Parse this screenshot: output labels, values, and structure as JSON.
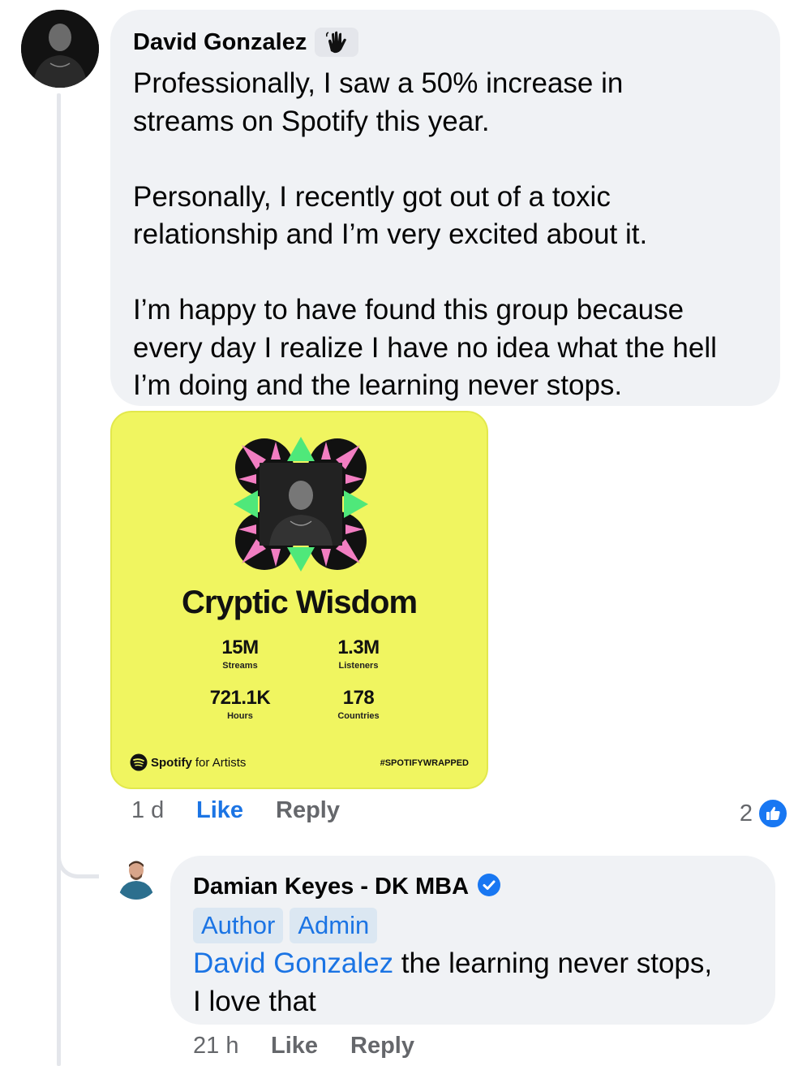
{
  "comment": {
    "author": "David Gonzalez",
    "paragraphs": [
      [
        "Professionally, I saw a 50% increase in",
        "streams on Spotify this year."
      ],
      [
        "Personally, I recently got out of a toxic",
        "relationship and I’m very excited about it."
      ],
      [
        "I’m happy to have found this group because",
        "every day I realize I have no idea what the hell",
        "I’m doing and the learning never stops."
      ]
    ],
    "badge_icon": "wave-hand-icon",
    "card": {
      "artist": "Cryptic Wisdom",
      "stats": [
        {
          "value": "15M",
          "label": "Streams"
        },
        {
          "value": "1.3M",
          "label": "Listeners"
        },
        {
          "value": "721.1K",
          "label": "Hours"
        },
        {
          "value": "178",
          "label": "Countries"
        }
      ],
      "brand": "Spotify",
      "brand_suffix": "for Artists",
      "hashtag": "#SPOTIFYWRAPPED",
      "colors": {
        "background": "#f0f560",
        "pink": "#f27ec2",
        "green": "#4fe87a"
      }
    },
    "time": "1 d",
    "like_label": "Like",
    "reply_label": "Reply",
    "reaction_count": "2"
  },
  "reply": {
    "author": "Damian Keyes - DK MBA",
    "verified_icon": "verified-badge-icon",
    "tags": [
      "Author",
      "Admin"
    ],
    "mention": "David Gonzalez",
    "text_line1": " the learning never stops,",
    "text_line2": "I love that",
    "time": "21 h",
    "like_label": "Like",
    "reply_label": "Reply"
  },
  "colors": {
    "accent": "#1b74e4",
    "bubble": "#f0f2f5",
    "muted": "#65676b"
  }
}
